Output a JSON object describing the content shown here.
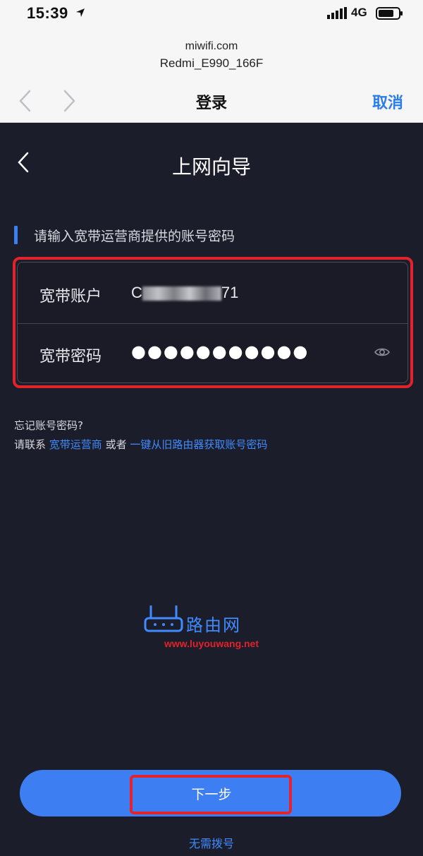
{
  "status_bar": {
    "time": "15:39",
    "network": "4G"
  },
  "browser": {
    "host": "miwifi.com",
    "ssid": "Redmi_E990_166F",
    "title": "登录",
    "cancel_label": "取消"
  },
  "page": {
    "title": "上网向导",
    "section_label": "请输入宽带运营商提供的账号密码"
  },
  "form": {
    "account_label": "宽带账户",
    "account_value_start": "C",
    "account_value_end": "71",
    "password_label": "宽带密码",
    "password_value": "●●●●●●●●●●●"
  },
  "help": {
    "forgot_text": "忘记账号密码?",
    "contact_prefix": "请联系",
    "isp_link": "宽带运营商",
    "or_text": "或者",
    "old_router_link": "一键从旧路由器获取账号密码"
  },
  "watermark": {
    "brand": "路由网",
    "url": "www.luyouwang.net"
  },
  "actions": {
    "next_label": "下一步",
    "no_dial_label": "无需拨号"
  },
  "colors": {
    "accent": "#3d7ff2",
    "highlight": "#e2232b",
    "background": "#1c1d2a"
  }
}
